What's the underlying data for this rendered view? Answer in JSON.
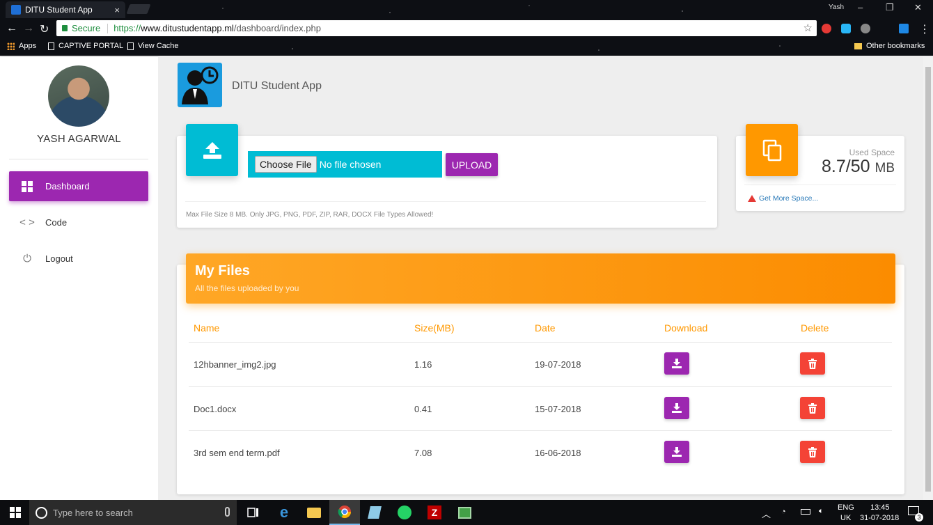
{
  "browser": {
    "tab_title": "DITU Student App",
    "tab_close": "×",
    "window_user": "Yash",
    "controls": [
      "–",
      "❐",
      "✕"
    ],
    "secure_label": "Secure",
    "url_scheme": "https://",
    "url_host": "www.ditustudentapp.ml",
    "url_path": "/dashboard/index.php",
    "star": "☆",
    "menu": "⋮",
    "bookmarks": {
      "apps": "Apps",
      "captive": "CAPTIVE PORTAL",
      "cache": "View Cache",
      "other": "Other bookmarks"
    }
  },
  "sidebar": {
    "user_name": "YASH AGARWAL",
    "items": [
      {
        "label": "Dashboard",
        "icon": "dashboard-icon",
        "active": true
      },
      {
        "label": "Code",
        "icon": "code-icon",
        "active": false
      },
      {
        "label": "Logout",
        "icon": "power-icon",
        "active": false
      }
    ],
    "code_glyph": "< >",
    "power_glyph": "⏻"
  },
  "header": {
    "brand": "DITU Student App"
  },
  "upload": {
    "choose_label": "Choose File",
    "no_file": "No file chosen",
    "upload_label": "UPLOAD",
    "note": "Max File Size 8 MB. Only JPG, PNG, PDF, ZIP, RAR, DOCX File Types Allowed!"
  },
  "space": {
    "label": "Used Space",
    "value": "8.7/50",
    "unit": "MB",
    "more": "Get More Space..."
  },
  "files": {
    "title": "My Files",
    "subtitle": "All the files uploaded by you",
    "columns": [
      "Name",
      "Size(MB)",
      "Date",
      "Download",
      "Delete"
    ],
    "rows": [
      {
        "name": "12hbanner_img2.jpg",
        "size": "1.16",
        "date": "19-07-2018"
      },
      {
        "name": "Doc1.docx",
        "size": "0.41",
        "date": "15-07-2018"
      },
      {
        "name": "3rd sem end term.pdf",
        "size": "7.08",
        "date": "16-06-2018"
      }
    ]
  },
  "taskbar": {
    "search_placeholder": "Type here to search",
    "lang_top": "ENG",
    "lang_bottom": "UK",
    "time": "13:45",
    "date": "31-07-2018",
    "notifications": "3"
  },
  "colors": {
    "purple": "#9c27b0",
    "cyan": "#00bcd4",
    "orange": "#ff9800",
    "red": "#f44336"
  }
}
